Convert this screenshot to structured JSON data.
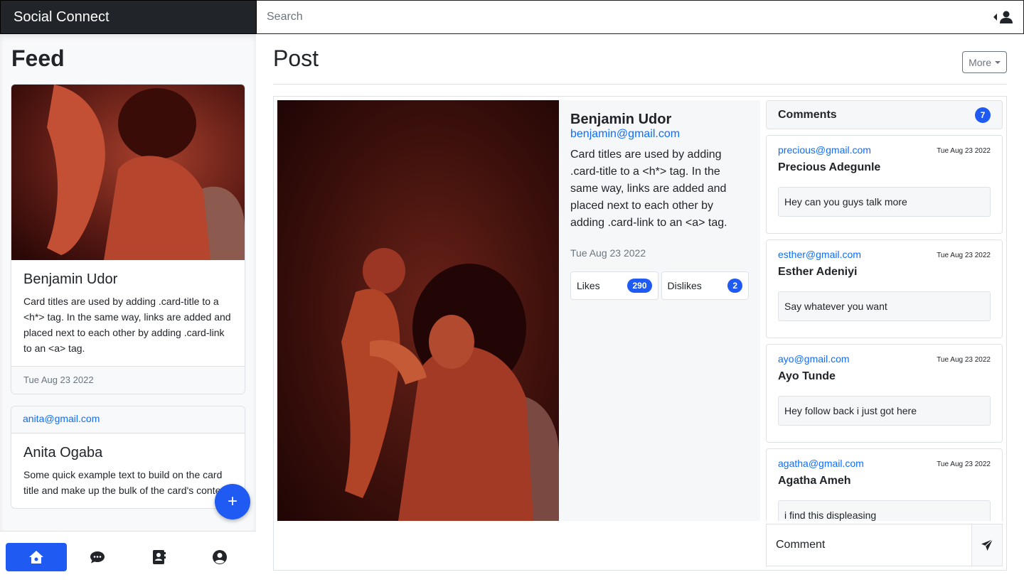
{
  "app": {
    "title": "Social Connect"
  },
  "search": {
    "placeholder": "Search"
  },
  "sidebar": {
    "title": "Feed",
    "cards": [
      {
        "name": "Benjamin Udor",
        "text": "Card titles are used by adding .card-title to a <h*> tag. In the same way, links are added and placed next to each other by adding .card-link to an <a> tag.",
        "date": "Tue Aug 23 2022"
      },
      {
        "email": "anita@gmail.com",
        "name": "Anita Ogaba",
        "text": "Some quick example text to build on the card title and make up the bulk of the card's content."
      }
    ],
    "fab_label": "+"
  },
  "bottom_nav": [
    "home-icon",
    "chat-icon",
    "contacts-icon",
    "profile-icon"
  ],
  "post": {
    "title": "Post",
    "more_label": "More",
    "author": "Benjamin Udor",
    "email": "benjamin@gmail.com",
    "text": "Card titles are used by adding .card-title to a <h*> tag. In the same way, links are added and placed next to each other by adding .card-link to an <a> tag.",
    "date": "Tue Aug 23 2022",
    "likes_label": "Likes",
    "likes": "290",
    "dislikes_label": "Dislikes",
    "dislikes": "2"
  },
  "comments": {
    "title": "Comments",
    "count": "7",
    "items": [
      {
        "email": "precious@gmail.com",
        "date": "Tue Aug 23 2022",
        "name": "Precious Adegunle",
        "text": "Hey can you guys talk more"
      },
      {
        "email": "esther@gmail.com",
        "date": "Tue Aug 23 2022",
        "name": "Esther Adeniyi",
        "text": "Say whatever you want"
      },
      {
        "email": "ayo@gmail.com",
        "date": "Tue Aug 23 2022",
        "name": "Ayo Tunde",
        "text": "Hey follow back i just got here"
      },
      {
        "email": "agatha@gmail.com",
        "date": "Tue Aug 23 2022",
        "name": "Agatha Ameh",
        "text": "i find this displeasing"
      }
    ],
    "input_placeholder": "Comment"
  },
  "colors": {
    "accent": "#1f5af2",
    "navbar": "#212529",
    "link": "#0d6efd"
  }
}
